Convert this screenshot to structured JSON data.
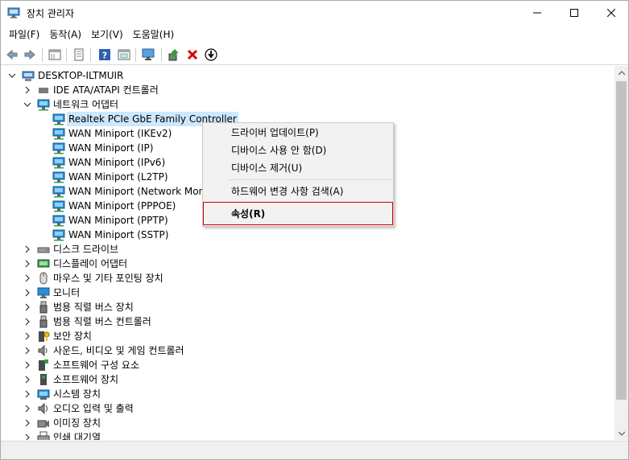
{
  "window": {
    "title": "장치 관리자"
  },
  "menu": [
    "파일(F)",
    "동작(A)",
    "보기(V)",
    "도움말(H)"
  ],
  "toolbar": {
    "icons": [
      "back-arrow-icon",
      "forward-arrow-icon",
      "properties-view-icon",
      "device-list-icon",
      "help-icon",
      "show-hidden-icon",
      "monitor-scan-icon",
      "update-driver-icon",
      "uninstall-device-icon",
      "download-icon"
    ]
  },
  "tree": {
    "root": "DESKTOP-ILTMUIR",
    "items": [
      {
        "label": "IDE ATA/ATAPI 컨트롤러",
        "expanded": false,
        "icon": "ide-controller-icon"
      },
      {
        "label": "네트워크 어댑터",
        "expanded": true,
        "icon": "network-adapter-icon",
        "children": [
          {
            "label": "Realtek PCIe GbE Family Controller",
            "selected": true
          },
          {
            "label": "WAN Miniport (IKEv2)"
          },
          {
            "label": "WAN Miniport (IP)"
          },
          {
            "label": "WAN Miniport (IPv6)"
          },
          {
            "label": "WAN Miniport (L2TP)"
          },
          {
            "label": "WAN Miniport (Network Monit"
          },
          {
            "label": "WAN Miniport (PPPOE)"
          },
          {
            "label": "WAN Miniport (PPTP)"
          },
          {
            "label": "WAN Miniport (SSTP)"
          }
        ]
      },
      {
        "label": "디스크 드라이브",
        "expanded": false,
        "icon": "disk-drive-icon"
      },
      {
        "label": "디스플레이 어댑터",
        "expanded": false,
        "icon": "display-adapter-icon"
      },
      {
        "label": "마우스 및 기타 포인팅 장치",
        "expanded": false,
        "icon": "mouse-icon"
      },
      {
        "label": "모니터",
        "expanded": false,
        "icon": "monitor-icon"
      },
      {
        "label": "범용 직렬 버스 장치",
        "expanded": false,
        "icon": "usb-icon"
      },
      {
        "label": "범용 직렬 버스 컨트롤러",
        "expanded": false,
        "icon": "usb-icon"
      },
      {
        "label": "보안 장치",
        "expanded": false,
        "icon": "security-key-icon"
      },
      {
        "label": "사운드, 비디오 및 게임 컨트롤러",
        "expanded": false,
        "icon": "speaker-icon"
      },
      {
        "label": "소프트웨어 구성 요소",
        "expanded": false,
        "icon": "software-component-icon"
      },
      {
        "label": "소프트웨어 장치",
        "expanded": false,
        "icon": "software-device-icon"
      },
      {
        "label": "시스템 장치",
        "expanded": false,
        "icon": "system-device-icon"
      },
      {
        "label": "오디오 입력 및 출력",
        "expanded": false,
        "icon": "audio-io-icon"
      },
      {
        "label": "이미징 장치",
        "expanded": false,
        "icon": "camera-icon"
      },
      {
        "label": "인쇄 대기열",
        "expanded": false,
        "icon": "printer-icon"
      }
    ]
  },
  "context_menu": {
    "items": [
      {
        "label": "드라이버 업데이트(P)"
      },
      {
        "label": "디바이스 사용 안 함(D)"
      },
      {
        "label": "디바이스 제거(U)"
      },
      {
        "label": "하드웨어 변경 사항 검색(A)"
      },
      {
        "label": "속성(R)",
        "bold": true,
        "highlighted": true
      }
    ]
  },
  "colors": {
    "selection": "#cce8ff",
    "highlight_border": "#d40000",
    "network_icon": "#1a7fd6"
  }
}
